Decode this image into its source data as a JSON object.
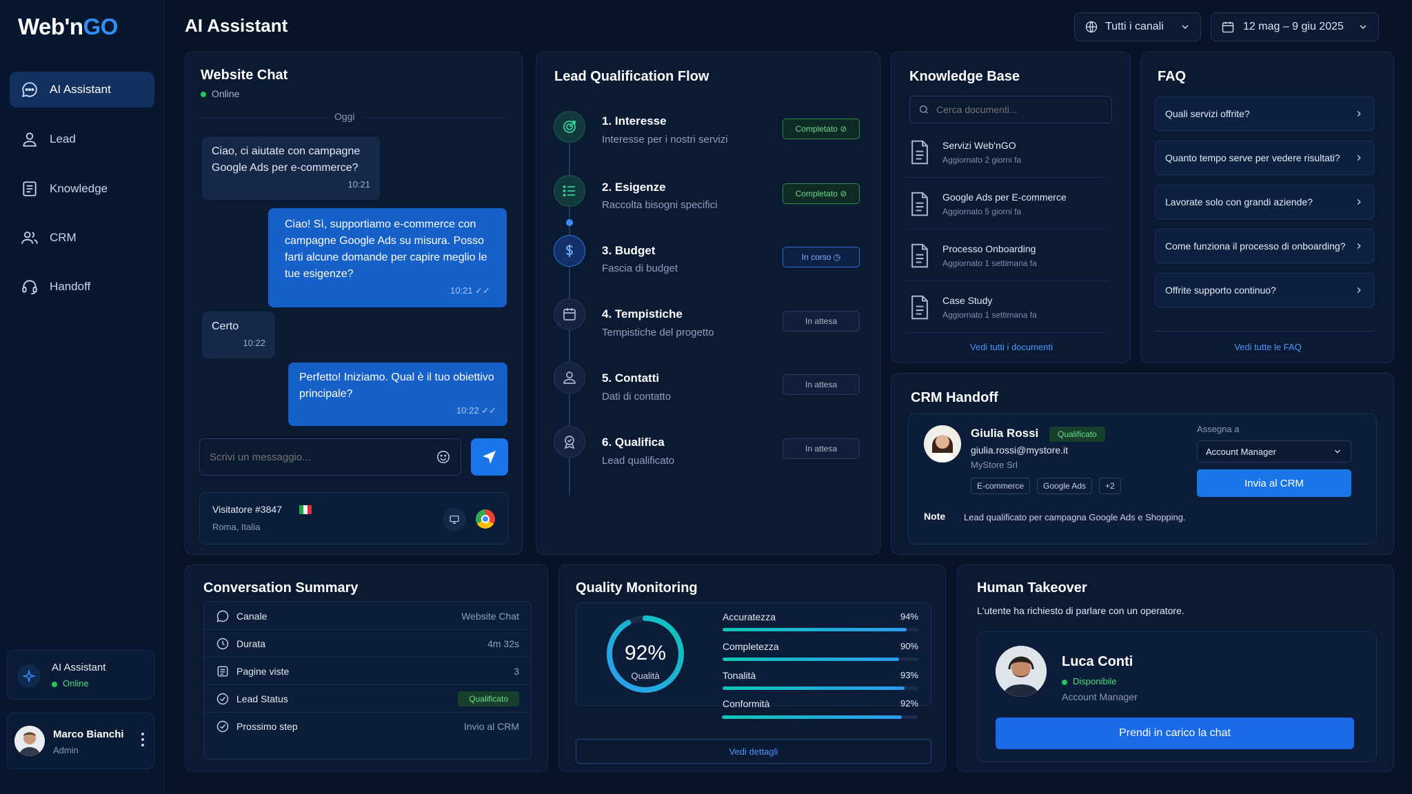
{
  "brand": {
    "part1": "Web'n",
    "part2": "GO"
  },
  "page_title": "AI Assistant",
  "sidebar": {
    "items": [
      {
        "label": "AI Assistant",
        "icon": "chat-bubble-icon",
        "active": true
      },
      {
        "label": "Lead",
        "icon": "user-icon"
      },
      {
        "label": "Knowledge",
        "icon": "book-icon"
      },
      {
        "label": "CRM",
        "icon": "users-icon"
      },
      {
        "label": "Handoff",
        "icon": "headset-icon"
      }
    ],
    "assistant_card": {
      "title": "AI Assistant",
      "status": "Online"
    },
    "user": {
      "name": "Marco Bianchi",
      "role": "Admin"
    }
  },
  "filters": {
    "channel": "Tutti i canali",
    "date_range": "12 mag – 9 giu 2025"
  },
  "chat": {
    "title": "Website Chat",
    "status": "Online",
    "day_label": "Oggi",
    "messages": [
      {
        "dir": "in",
        "text": "Ciao, ci aiutate con campagne Google Ads per e-commerce?",
        "time": "10:21"
      },
      {
        "dir": "out",
        "text": "Ciao! Sì, supportiamo e-commerce con campagne Google Ads su misura. Posso farti alcune domande per capire meglio le tue esigenze?",
        "time": "10:21"
      },
      {
        "dir": "in",
        "text": "Certo",
        "time": "10:22"
      },
      {
        "dir": "out",
        "text": "Perfetto! Iniziamo. Qual è il tuo obiettivo principale?",
        "time": "10:22"
      }
    ],
    "input_placeholder": "Scrivi un messaggio...",
    "visitor": {
      "name": "Visitatore #3847",
      "location": "Roma, Italia"
    }
  },
  "flow": {
    "title": "Lead Qualification Flow",
    "steps": [
      {
        "title": "1. Interesse",
        "sub": "Interesse per i nostri servizi",
        "status": "Completato",
        "state": "done",
        "icon": "target-icon"
      },
      {
        "title": "2. Esigenze",
        "sub": "Raccolta bisogni specifici",
        "status": "Completato",
        "state": "done",
        "icon": "list-icon"
      },
      {
        "title": "3. Budget",
        "sub": "Fascia di budget",
        "status": "In corso",
        "state": "prog",
        "icon": "dollar-icon"
      },
      {
        "title": "4. Tempistiche",
        "sub": "Tempistiche del progetto",
        "status": "In attesa",
        "state": "wait",
        "icon": "calendar-icon"
      },
      {
        "title": "5. Contatti",
        "sub": "Dati di contatto",
        "status": "In attesa",
        "state": "wait",
        "icon": "person-icon"
      },
      {
        "title": "6. Qualifica",
        "sub": "Lead qualificato",
        "status": "In attesa",
        "state": "wait",
        "icon": "award-icon"
      }
    ]
  },
  "kb": {
    "title": "Knowledge Base",
    "search_placeholder": "Cerca documenti...",
    "docs": [
      {
        "name": "Servizi Web'nGO",
        "date": "Aggiornato 2 giorni fa"
      },
      {
        "name": "Google Ads per E-commerce",
        "date": "Aggiornato 5 giorni fa"
      },
      {
        "name": "Processo Onboarding",
        "date": "Aggiornato 1 settimana fa"
      },
      {
        "name": "Case Study",
        "date": "Aggiornato 1 settimana fa"
      }
    ],
    "link": "Vedi tutti i documenti"
  },
  "faq": {
    "title": "FAQ",
    "items": [
      "Quali servizi offrite?",
      "Quanto tempo serve per vedere risultati?",
      "Lavorate solo con grandi aziende?",
      "Come funziona il processo di onboarding?",
      "Offrite supporto continuo?"
    ],
    "link": "Vedi tutte le FAQ"
  },
  "crm": {
    "title": "CRM Handoff",
    "lead": {
      "name": "Giulia Rossi",
      "badge": "Qualificato",
      "email": "giulia.rossi@mystore.it",
      "company": "MyStore Srl",
      "tags": [
        "E-commerce",
        "Google Ads",
        "+2"
      ]
    },
    "assign_label": "Assegna a",
    "assign_value": "Account Manager",
    "send_button": "Invia al CRM",
    "note_label": "Note",
    "note_text": "Lead qualificato per campagna Google Ads e Shopping."
  },
  "summary": {
    "title": "Conversation Summary",
    "rows": [
      {
        "label": "Canale",
        "value": "Website Chat",
        "icon": "chat-icon"
      },
      {
        "label": "Durata",
        "value": "4m 32s",
        "icon": "clock-icon"
      },
      {
        "label": "Pagine viste",
        "value": "3",
        "icon": "pages-icon"
      },
      {
        "label": "Lead Status",
        "value": "Qualificato",
        "icon": "check-circle-icon",
        "badge": true
      },
      {
        "label": "Prossimo step",
        "value": "Invio al CRM",
        "icon": "check-circle-icon"
      }
    ]
  },
  "quality": {
    "title": "Quality Monitoring",
    "score": "92%",
    "score_value": 92,
    "score_label": "Qualità",
    "metrics": [
      {
        "label": "Accuratezza",
        "pct": "94%",
        "value": 94
      },
      {
        "label": "Completezza",
        "pct": "90%",
        "value": 90
      },
      {
        "label": "Tonalità",
        "pct": "93%",
        "value": 93
      },
      {
        "label": "Conformità",
        "pct": "92%",
        "value": 92
      }
    ],
    "link": "Vedi dettagli"
  },
  "takeover": {
    "title": "Human Takeover",
    "desc": "L'utente ha richiesto di parlare con un operatore.",
    "operator": {
      "name": "Luca Conti",
      "status": "Disponibile",
      "role": "Account Manager"
    },
    "button": "Prendi in carico la chat"
  },
  "colors": {
    "accent": "#1660c9",
    "success": "#22c55e",
    "background": "#071427"
  }
}
